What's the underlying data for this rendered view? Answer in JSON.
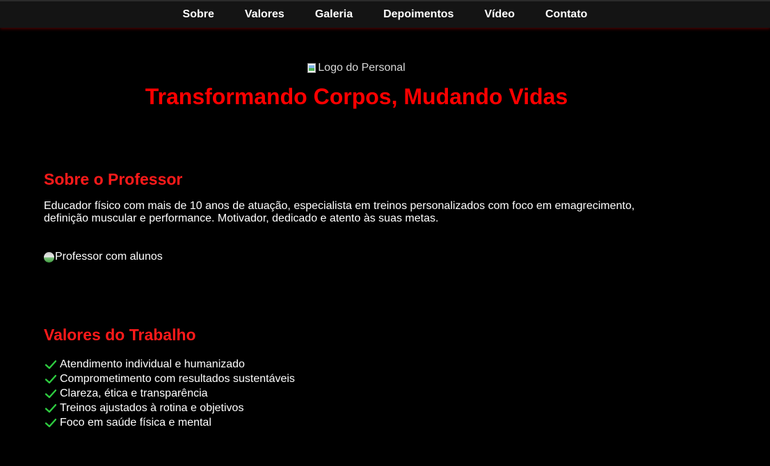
{
  "nav": {
    "items": [
      {
        "label": "Sobre"
      },
      {
        "label": "Valores"
      },
      {
        "label": "Galeria"
      },
      {
        "label": "Depoimentos"
      },
      {
        "label": "Vídeo"
      },
      {
        "label": "Contato"
      }
    ]
  },
  "hero": {
    "logo_alt": "Logo do Personal",
    "title": "Transformando Corpos, Mudando Vidas"
  },
  "about": {
    "title": "Sobre o Professor",
    "text": "Educador físico com mais de 10 anos de atuação, especialista em treinos personalizados com foco em emagrecimento, definição muscular e performance. Motivador, dedicado e atento às suas metas.",
    "photo_alt": "Professor com alunos"
  },
  "values": {
    "title": "Valores do Trabalho",
    "items": [
      "Atendimento individual e humanizado",
      "Comprometimento com resultados sustentáveis",
      "Clareza, ética e transparência",
      "Treinos ajustados à rotina e objetivos",
      "Foco em saúde física e mental"
    ],
    "check_icon": "check-icon",
    "check_color": "#2ecc40"
  },
  "colors": {
    "accent": "#ff0000",
    "background": "#000000",
    "nav_background": "#141414"
  }
}
